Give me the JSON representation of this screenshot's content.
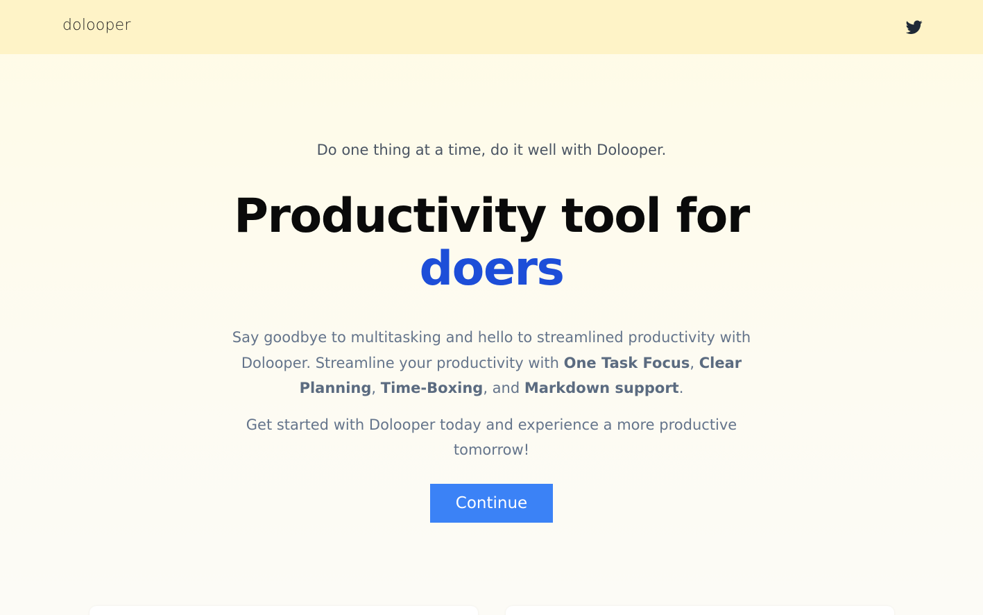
{
  "header": {
    "logo_text": "dolooper",
    "twitter_icon": "twitter-icon"
  },
  "hero": {
    "tagline": "Do one thing at a time, do it well with Dolooper.",
    "headline_main": "Productivity tool for",
    "headline_accent": "doers",
    "description_intro": "Say goodbye to multitasking and hello to streamlined productivity with Dolooper. Streamline your productivity with ",
    "feature_1": "One Task Focus",
    "sep_1": ", ",
    "feature_2": "Clear Planning",
    "sep_2": ", ",
    "feature_3": "Time-Boxing",
    "sep_3": ", and ",
    "feature_4": "Markdown support",
    "description_end": ".",
    "cta_text": "Get started with Dolooper today and experience a more productive tomorrow!",
    "continue_label": "Continue"
  },
  "colors": {
    "header_bg": "#fef3c7",
    "accent": "#1d4ed8",
    "button": "#3b82f6"
  }
}
